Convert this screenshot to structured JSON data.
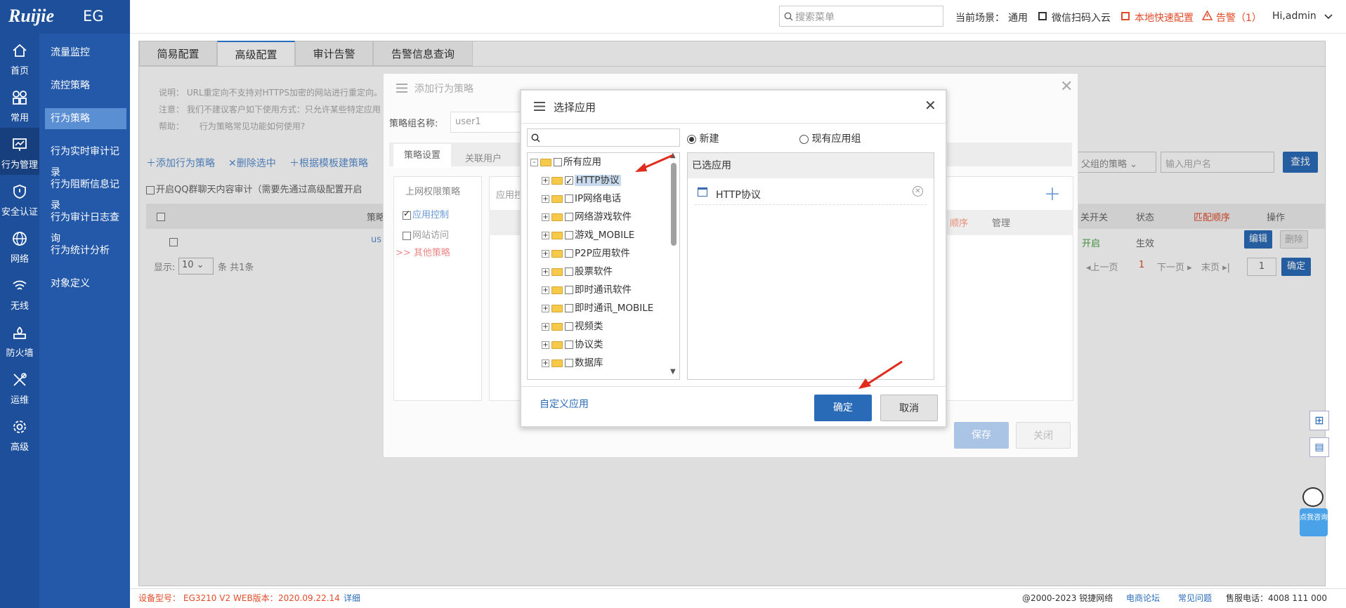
{
  "brand": {
    "logo": "Ruijie",
    "product": "EG"
  },
  "topbar": {
    "search_placeholder": "搜索菜单",
    "scene_label": "当前场景：",
    "scene_value": "通用",
    "wechat": "微信扫码入云",
    "quick_config": "本地快速配置",
    "alarm": "告警（1）",
    "user": "Hi,admin"
  },
  "rail": [
    {
      "label": "首页",
      "icon": "home-icon"
    },
    {
      "label": "常用",
      "icon": "grid-icon"
    },
    {
      "label": "行为管理",
      "icon": "behavior-icon"
    },
    {
      "label": "安全认证",
      "icon": "shield-icon"
    },
    {
      "label": "网络",
      "icon": "globe-icon"
    },
    {
      "label": "无线",
      "icon": "wifi-icon"
    },
    {
      "label": "防火墙",
      "icon": "firewall-icon"
    },
    {
      "label": "运维",
      "icon": "tools-icon"
    },
    {
      "label": "高级",
      "icon": "gear-icon"
    }
  ],
  "subnav": [
    "流量监控",
    "流控策略",
    "行为策略",
    "行为实时审计记录",
    "行为阻断信息记录",
    "行为审计日志查询",
    "行为统计分析",
    "对象定义"
  ],
  "tabs": [
    "简易配置",
    "高级配置",
    "审计告警",
    "告警信息查询"
  ],
  "notes": {
    "l1_label": "说明：",
    "l1_text": "URL重定向不支持对HTTPS加密的网站进行重定向。",
    "l2_label": "注意：",
    "l2_text": "我们不建议客户如下使用方式：只允许某些特定应用",
    "l3_label": "帮助：",
    "l3_text": "行为策略常见功能如何使用?"
  },
  "toolbar": {
    "add": "添加行为策略",
    "delete": "删除选中",
    "template": "根据模板建策略",
    "qq": "开启QQ群聊天内容审计（需要先通过高级配置开启"
  },
  "table": {
    "col_name": "策略",
    "row_name": "us",
    "pager_show": "显示:",
    "pager_size": "10",
    "pager_total": "条 共1条",
    "filter_group": "父组的策略",
    "filter_user_placeholder": "输入用户名",
    "search": "查找",
    "col_switch": "关开关",
    "col_status": "状态",
    "col_order": "匹配顺序",
    "col_ops": "操作",
    "row_switch": "开启",
    "row_status": "生效",
    "edit": "编辑",
    "remove": "删除",
    "prev": "上一页",
    "page": "1",
    "next": "下一页",
    "last": "末页",
    "page_input": "1",
    "confirm": "确定"
  },
  "policy_dialog": {
    "title": "添加行为策略",
    "group_label": "策略组名称:",
    "group_value": "user1",
    "tab_settings": "策略设置",
    "tab_users": "关联用户",
    "side_title": "上网权限策略",
    "side_app": "应用控制",
    "side_web": "网站访问",
    "side_other": "其他策略",
    "app_col": "应用控",
    "order_col": "顺序",
    "manage_col": "管理",
    "save": "保存",
    "close": "关闭"
  },
  "app_dialog": {
    "title": "选择应用",
    "radio_new": "新建",
    "radio_existing": "现有应用组",
    "selected_header": "已选应用",
    "selected_items": [
      "HTTP协议"
    ],
    "tree_root": "所有应用",
    "tree_items": [
      {
        "label": "HTTP协议",
        "checked": true
      },
      {
        "label": "IP网络电话",
        "checked": false
      },
      {
        "label": "网络游戏软件",
        "checked": false
      },
      {
        "label": "游戏_MOBILE",
        "checked": false
      },
      {
        "label": "P2P应用软件",
        "checked": false
      },
      {
        "label": "股票软件",
        "checked": false
      },
      {
        "label": "即时通讯软件",
        "checked": false
      },
      {
        "label": "即时通讯_MOBILE",
        "checked": false
      },
      {
        "label": "视频类",
        "checked": false
      },
      {
        "label": "协议类",
        "checked": false
      },
      {
        "label": "数据库",
        "checked": false
      }
    ],
    "custom_link": "自定义应用",
    "ok": "确定",
    "cancel": "取消"
  },
  "footer": {
    "model_label": "设备型号：",
    "model": "EG3210 V2",
    "web_label": "WEB版本：",
    "web": "2020.09.22.14",
    "detail": "详细",
    "copyright": "@2000-2023 锐捷网络",
    "forum": "电商论坛",
    "faq": "常见问题",
    "service": "售服电话：4008 111 000"
  },
  "assistant": {
    "label": "点我咨询"
  },
  "colors": {
    "rail": "#1d4f9a",
    "subnav": "#2359a8",
    "primary": "#2a6bb8",
    "alert": "#e24b2a"
  }
}
